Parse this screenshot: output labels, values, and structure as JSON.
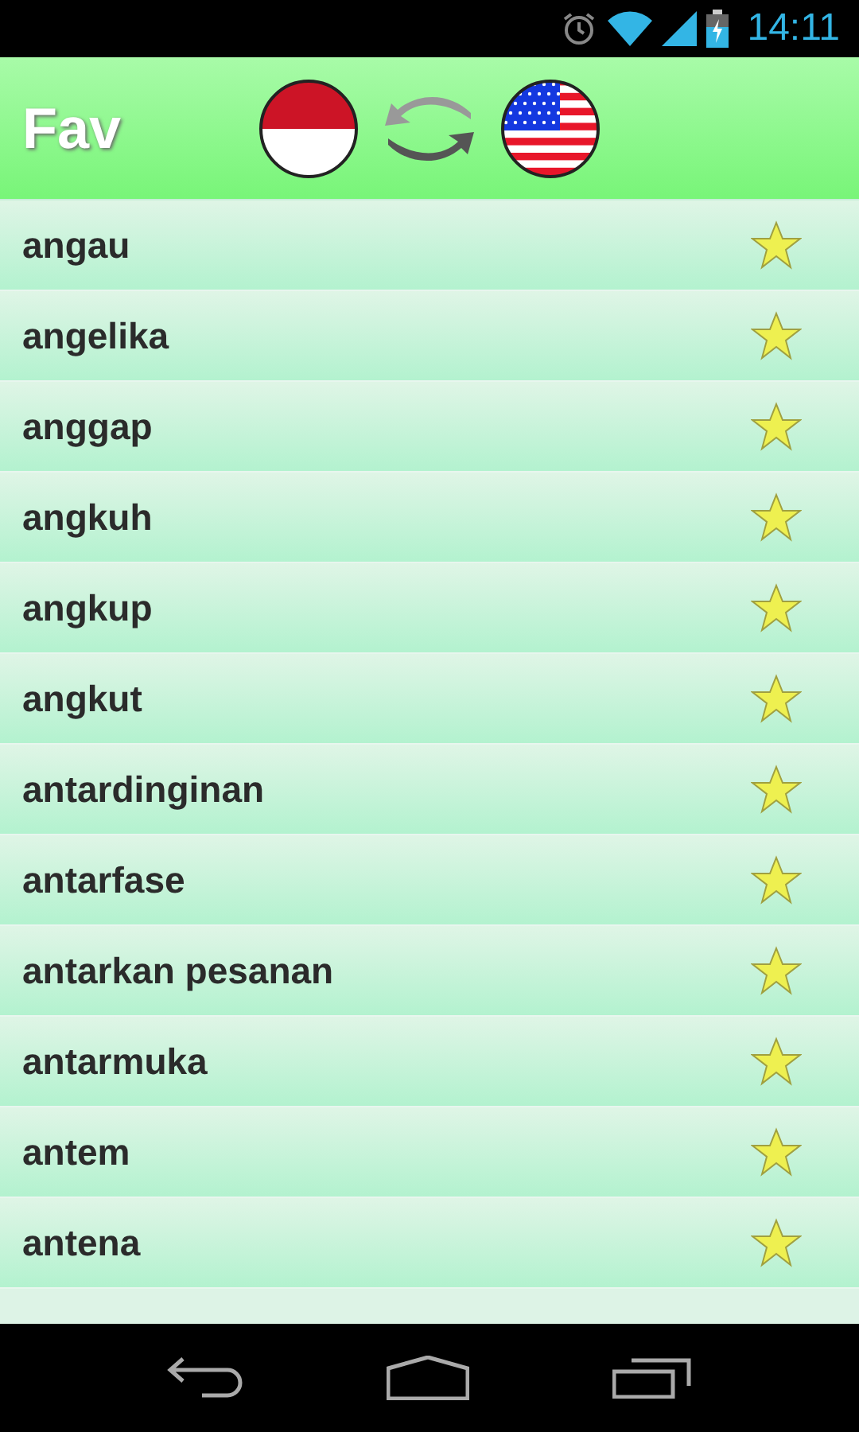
{
  "status_bar": {
    "time": "14:11"
  },
  "header": {
    "title": "Fav"
  },
  "words": [
    {
      "text": "angau",
      "favorite": true
    },
    {
      "text": "angelika",
      "favorite": true
    },
    {
      "text": "anggap",
      "favorite": true
    },
    {
      "text": "angkuh",
      "favorite": true
    },
    {
      "text": "angkup",
      "favorite": true
    },
    {
      "text": "angkut",
      "favorite": true
    },
    {
      "text": "antardinginan",
      "favorite": true
    },
    {
      "text": "antarfase",
      "favorite": true
    },
    {
      "text": "antarkan pesanan",
      "favorite": true
    },
    {
      "text": "antarmuka",
      "favorite": true
    },
    {
      "text": "antem",
      "favorite": true
    },
    {
      "text": "antena",
      "favorite": true
    }
  ]
}
